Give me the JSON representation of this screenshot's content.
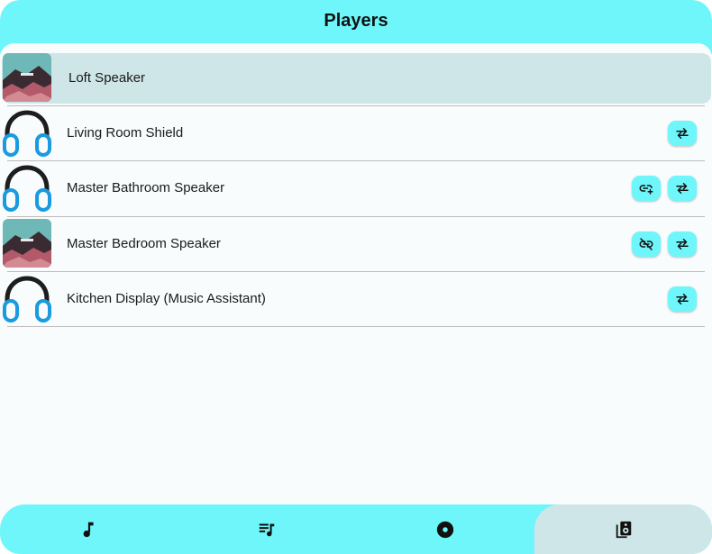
{
  "header": {
    "title": "Players"
  },
  "players": [
    {
      "name": "Loft Speaker",
      "thumb": "album-art",
      "selected": true,
      "actions": []
    },
    {
      "name": "Living Room Shield",
      "thumb": "headphones-icon",
      "selected": false,
      "actions": [
        "transfer-icon"
      ]
    },
    {
      "name": "Master Bathroom Speaker",
      "thumb": "headphones-icon",
      "selected": false,
      "actions": [
        "link-add-icon",
        "transfer-icon"
      ]
    },
    {
      "name": "Master Bedroom Speaker",
      "thumb": "album-art",
      "selected": false,
      "actions": [
        "link-off-icon",
        "transfer-icon"
      ]
    },
    {
      "name": "Kitchen Display (Music Assistant)",
      "thumb": "headphones-icon",
      "selected": false,
      "actions": [
        "transfer-icon"
      ]
    }
  ],
  "bottom_nav": {
    "items": [
      {
        "icon": "music-note-icon",
        "active": false
      },
      {
        "icon": "queue-music-icon",
        "active": false
      },
      {
        "icon": "album-icon",
        "active": false
      },
      {
        "icon": "speaker-group-icon",
        "active": true
      }
    ]
  },
  "colors": {
    "accent": "#6ff6fb",
    "selected": "#cee6e8",
    "background": "#f9fcfc",
    "headphone_blue": "#1a9be0"
  }
}
